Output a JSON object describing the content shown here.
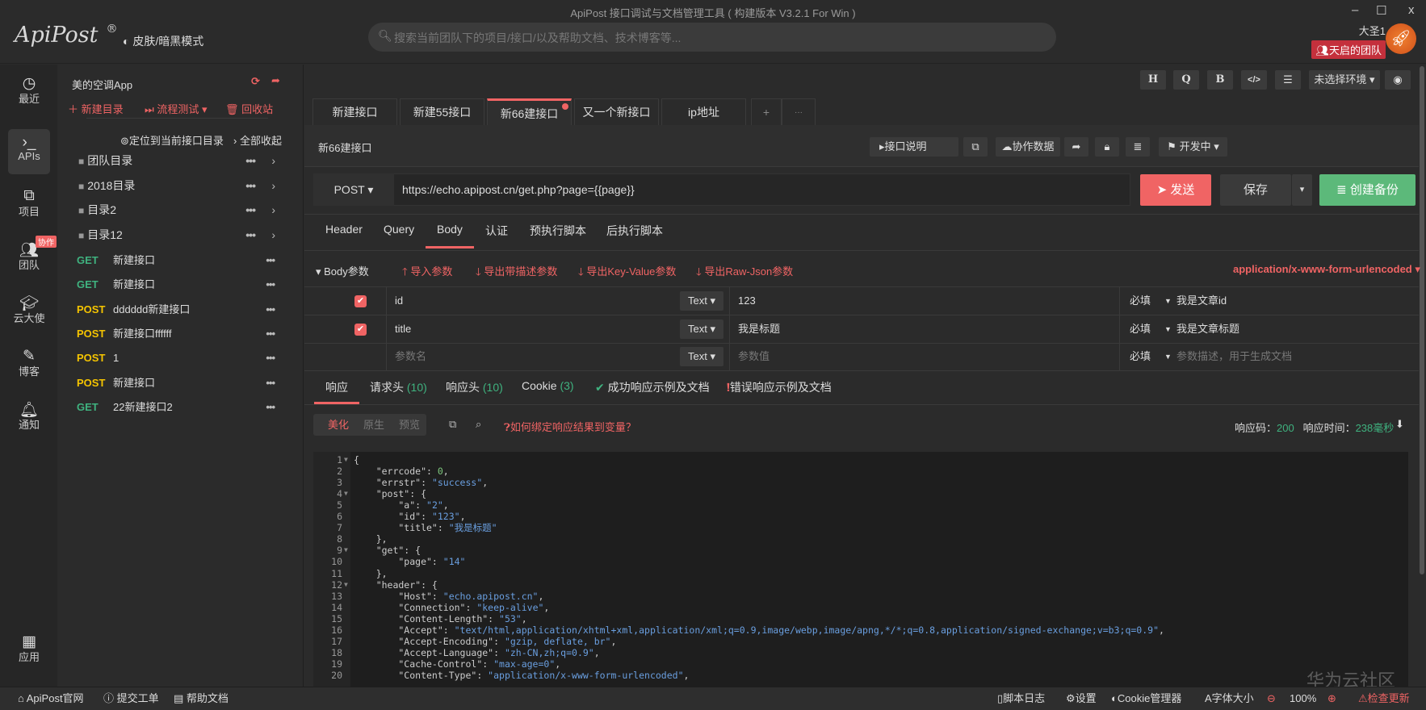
{
  "window": {
    "title": "ApiPost 接口调试与文档管理工具 ( 构建版本 V3.2.1 For Win )",
    "minimize": "–",
    "maximize": "☐",
    "close": "x"
  },
  "header": {
    "logo": "ApiPost",
    "logo_mark": "®",
    "skin_toggle": "皮肤/暗黑模式",
    "search_placeholder": "搜索当前团队下的项目/接口/以及帮助文档、技术博客等...",
    "user_name": "大圣1",
    "team": "天启的团队"
  },
  "rail": [
    {
      "label": "最近",
      "icon": "clock-icon"
    },
    {
      "label": "APIs",
      "icon": "terminal-icon",
      "active": true
    },
    {
      "label": "项目",
      "icon": "project-icon"
    },
    {
      "label": "团队",
      "icon": "team-icon",
      "badge": "协作"
    },
    {
      "label": "云大使",
      "icon": "graduation-cap-icon"
    },
    {
      "label": "博客",
      "icon": "edit-icon"
    },
    {
      "label": "通知",
      "icon": "bell-icon"
    },
    {
      "label": "应用",
      "icon": "apps-icon"
    }
  ],
  "sidebar": {
    "project": "美的空调App",
    "new_folder": "新建目录",
    "flow_test": "流程测试",
    "recycle": "回收站",
    "locate": "定位到当前接口目录",
    "collapse_all": "全部收起",
    "folders": [
      "团队目录",
      "2018目录",
      "目录2",
      "目录12"
    ],
    "apis": [
      {
        "method": "GET",
        "name": "新建接口"
      },
      {
        "method": "GET",
        "name": "新建接口"
      },
      {
        "method": "POST",
        "name": "dddddd新建接口"
      },
      {
        "method": "POST",
        "name": "新建接口ffffff"
      },
      {
        "method": "POST",
        "name": "1"
      },
      {
        "method": "POST",
        "name": "新建接口"
      },
      {
        "method": "GET",
        "name": "22新建接口2"
      }
    ]
  },
  "toolbar": {
    "h": "H",
    "q": "Q",
    "b": "B",
    "code": "</>",
    "settings": "☰",
    "env": "未选择环境"
  },
  "tabs": [
    {
      "label": "新建接口"
    },
    {
      "label": "新建55接口"
    },
    {
      "label": "新66建接口",
      "active": true,
      "unsaved": true
    },
    {
      "label": "又一个新接口"
    },
    {
      "label": "ip地址"
    }
  ],
  "tabs_add": "+",
  "tabs_more": "···",
  "request": {
    "name": "新66建接口",
    "doc_btn": "接口说明",
    "collab_btn": "协作数据",
    "status": "开发中",
    "method": "POST",
    "url": "https://echo.apipost.cn/get.php?page={{page}}",
    "send": "发送",
    "save": "保存",
    "backup": "创建备份"
  },
  "request_tabs": [
    "Header",
    "Query",
    "Body",
    "认证",
    "预执行脚本",
    "后执行脚本"
  ],
  "active_request_tab": "Body",
  "body": {
    "title": "Body参数",
    "import": "导入参数",
    "export_desc": "导出带描述参数",
    "export_kv": "导出Key-Value参数",
    "export_raw": "导出Raw-Json参数",
    "content_type": "application/x-www-form-urlencoded",
    "rows": [
      {
        "checked": true,
        "key": "id",
        "type": "Text",
        "value": "123",
        "required": "必填",
        "desc": "我是文章id"
      },
      {
        "checked": true,
        "key": "title",
        "type": "Text",
        "value": "我是标题",
        "required": "必填",
        "desc": "我是文章标题"
      }
    ],
    "empty_row": {
      "key_placeholder": "参数名",
      "type": "Text",
      "value_placeholder": "参数值",
      "required": "必填",
      "desc_placeholder": "参数描述，用于生成文档"
    }
  },
  "response_tabs": [
    {
      "label": "响应"
    },
    {
      "label": "请求头",
      "count": "(10)"
    },
    {
      "label": "响应头",
      "count": "(10)"
    },
    {
      "label": "Cookie",
      "count": "(3)"
    },
    {
      "label": "成功响应示例及文档"
    },
    {
      "label": "错误响应示例及文档"
    }
  ],
  "response": {
    "views": [
      "美化",
      "原生",
      "预览"
    ],
    "active_view": "美化",
    "bind_help": "如何绑定响应结果到变量？",
    "code_label": "响应码：",
    "code": "200",
    "time_label": "响应时间：",
    "time": "238毫秒"
  },
  "code_lines": [
    {
      "ln": "1",
      "fold": true,
      "text": "{"
    },
    {
      "ln": "2",
      "text": "    \"errcode\": 0,"
    },
    {
      "ln": "3",
      "text": "    \"errstr\": \"success\","
    },
    {
      "ln": "4",
      "fold": true,
      "text": "    \"post\": {"
    },
    {
      "ln": "5",
      "text": "        \"a\": \"2\","
    },
    {
      "ln": "6",
      "text": "        \"id\": \"123\","
    },
    {
      "ln": "7",
      "text": "        \"title\": \"我是标题\""
    },
    {
      "ln": "8",
      "text": "    },"
    },
    {
      "ln": "9",
      "fold": true,
      "text": "    \"get\": {"
    },
    {
      "ln": "10",
      "text": "        \"page\": \"14\""
    },
    {
      "ln": "11",
      "text": "    },"
    },
    {
      "ln": "12",
      "fold": true,
      "text": "    \"header\": {"
    },
    {
      "ln": "13",
      "text": "        \"Host\": \"echo.apipost.cn\","
    },
    {
      "ln": "14",
      "text": "        \"Connection\": \"keep-alive\","
    },
    {
      "ln": "15",
      "text": "        \"Content-Length\": \"53\","
    },
    {
      "ln": "16",
      "text": "        \"Accept\": \"text/html,application/xhtml+xml,application/xml;q=0.9,image/webp,image/apng,*/*;q=0.8,application/signed-exchange;v=b3;q=0.9\","
    },
    {
      "ln": "17",
      "text": "        \"Accept-Encoding\": \"gzip, deflate, br\","
    },
    {
      "ln": "18",
      "text": "        \"Accept-Language\": \"zh-CN,zh;q=0.9\","
    },
    {
      "ln": "19",
      "text": "        \"Cache-Control\": \"max-age=0\","
    },
    {
      "ln": "20",
      "text": "        \"Content-Type\": \"application/x-www-form-urlencoded\","
    }
  ],
  "statusbar": {
    "website": "ApiPost官网",
    "ticket": "提交工单",
    "help": "帮助文档",
    "script_log": "脚本日志",
    "settings": "设置",
    "cookie_mgr": "Cookie管理器",
    "font_size": "字体大小",
    "zoom": "100%",
    "update": "检查更新"
  },
  "watermark": "华为云社区",
  "colors": {
    "accent": "#f06464",
    "get": "#3fb27f",
    "post": "#f5c400",
    "backup": "#5cb97a"
  }
}
